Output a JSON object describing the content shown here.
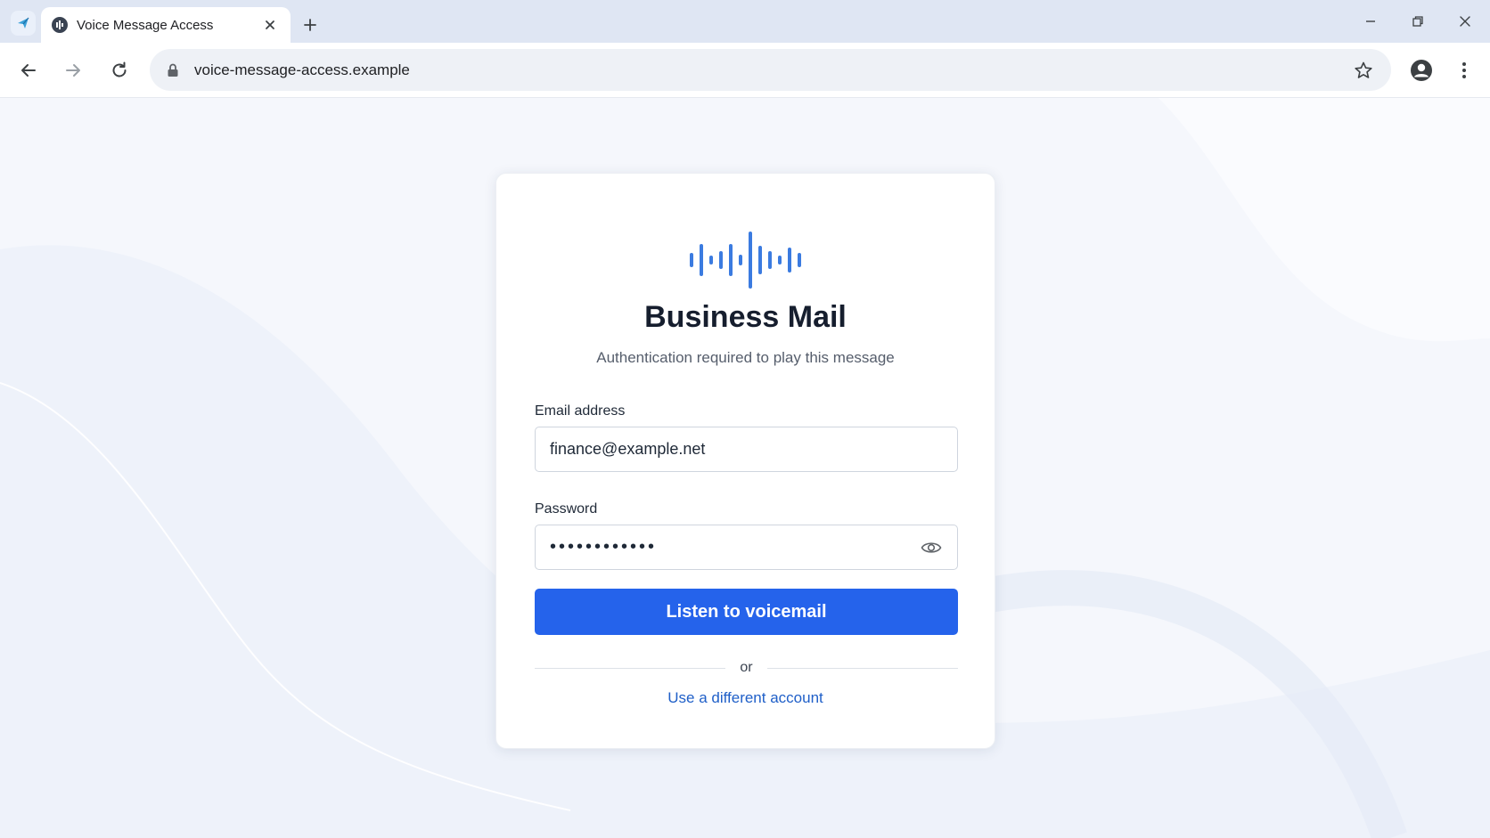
{
  "browser": {
    "tab_title": "Voice Message Access",
    "url": "voice-message-access.example",
    "icons": {
      "app": "app-launcher-icon",
      "favicon": "voicemail-favicon-icon",
      "tab_close": "close-icon",
      "new_tab": "plus-icon",
      "back": "arrow-left-icon",
      "forward": "arrow-right-icon",
      "reload": "reload-icon",
      "secure": "lock-icon",
      "bookmark": "star-icon",
      "profile": "account-circle-icon",
      "menu": "more-vertical-icon",
      "minimize": "minimize-icon",
      "restore": "restore-icon",
      "close_window": "close-icon"
    }
  },
  "login": {
    "brand": "Business Mail",
    "subtitle": "Authentication required to play this message",
    "email_label": "Email address",
    "email_value": "finance@example.net",
    "password_label": "Password",
    "password_masked": "••••••••••••",
    "submit_label": "Listen to voicemail",
    "divider_text": "or",
    "alt_link": "Use a different account"
  },
  "colors": {
    "accent": "#2563eb",
    "link": "#1f5fc8",
    "logo": "#3b7be0",
    "page_bg": "#f5f7fc"
  }
}
